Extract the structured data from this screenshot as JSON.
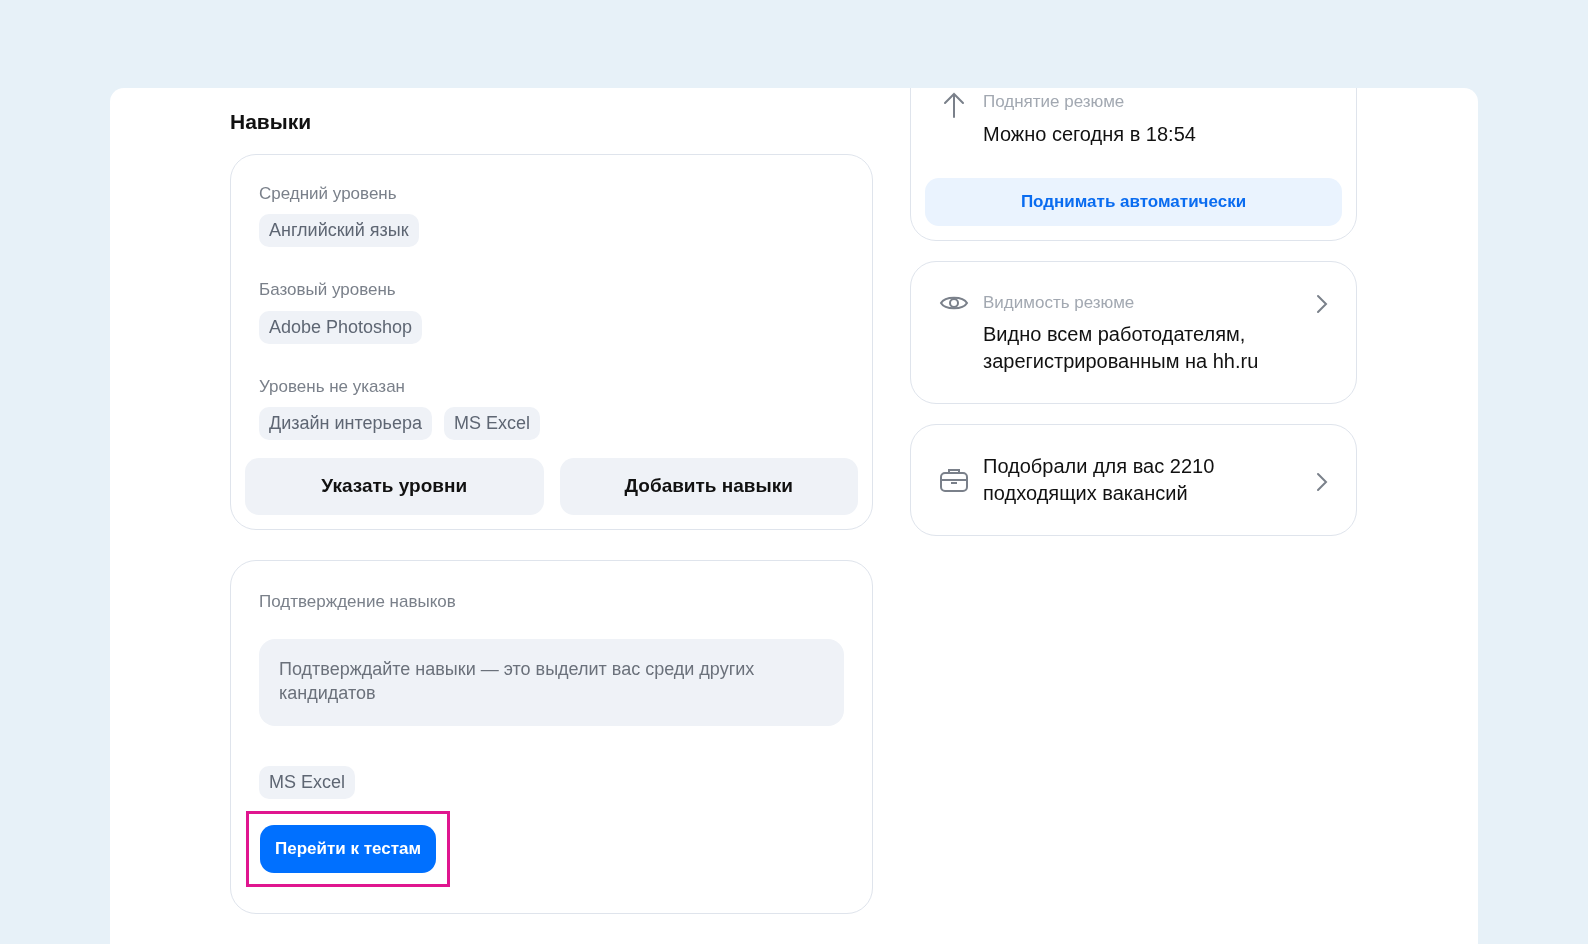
{
  "skills": {
    "title": "Навыки",
    "groups": [
      {
        "label": "Средний уровень",
        "tags": [
          "Английский язык"
        ]
      },
      {
        "label": "Базовый уровень",
        "tags": [
          "Adobe Photoshop"
        ]
      },
      {
        "label": "Уровень не указан",
        "tags": [
          "Дизайн интерьера",
          "MS Excel"
        ]
      }
    ],
    "buttons": [
      "Указать уровни",
      "Добавить навыки"
    ]
  },
  "verification": {
    "title": "Подтверждение навыков",
    "hint": "Подтверждайте навыки — это выделит вас среди других кандидатов",
    "tags": [
      "MS Excel"
    ],
    "button": {
      "label": "Перейти к тестам",
      "highlighted": true
    }
  },
  "side_cards": [
    {
      "kind": "raise",
      "label": "Поднятие резюме",
      "text": "Можно сегодня в 18:54",
      "button": "Поднимать автоматически"
    },
    {
      "kind": "visibility",
      "label": "Видимость резюме",
      "text": "Видно всем работодателям, зарегистрированным на hh.ru"
    },
    {
      "kind": "vacancies",
      "text": "Подобрали для вас 2210 подходящих вакансий"
    }
  ]
}
